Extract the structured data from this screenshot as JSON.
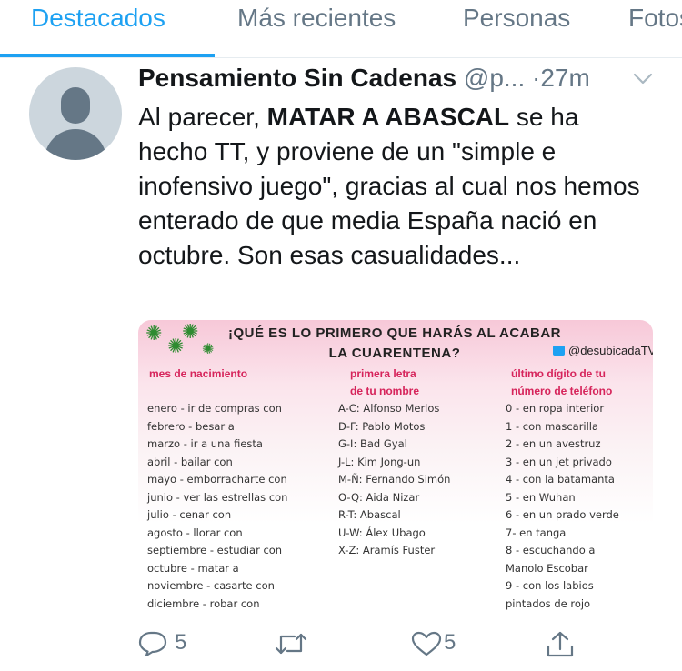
{
  "tabs": [
    {
      "label": "Destacados",
      "active": true
    },
    {
      "label": "Más recientes",
      "active": false
    },
    {
      "label": "Personas",
      "active": false
    },
    {
      "label": "Fotos",
      "active": false
    }
  ],
  "tweet": {
    "author_name": "Pensamiento Sin Cadenas",
    "handle": "@p...",
    "separator": "·",
    "time": "27m",
    "text_parts": [
      {
        "text": "Al parecer, ",
        "bold": false
      },
      {
        "text": "MATAR A ABASCAL",
        "bold": true
      },
      {
        "text": " se ha hecho TT, y proviene de un \"simple e inofensivo juego\", gracias al cual nos hemos enterado de que media España nació en octubre. Son esas casualidades...",
        "bold": false
      }
    ]
  },
  "image": {
    "title_line1": "¡QUÉ ES LO PRIMERO QUE HARÁS AL ACABAR",
    "title_line2": "LA CUARENTENA?",
    "handle": "@desubicadaTV",
    "col1_title": "mes de nacimiento",
    "col1_items": [
      "enero - ir de compras con",
      "febrero - besar a",
      "marzo - ir a una fiesta",
      "abril - bailar con",
      "mayo - emborracharte con",
      "junio - ver las estrellas con",
      "julio - cenar con",
      "agosto - llorar con",
      "septiembre - estudiar con",
      "octubre - matar a",
      "noviembre - casarte con",
      "diciembre - robar con"
    ],
    "col2_title_line1": "primera letra",
    "col2_title_line2": "de tu nombre",
    "col2_items": [
      "A-C: Alfonso Merlos",
      "D-F: Pablo Motos",
      "G-I: Bad Gyal",
      "J-L: Kim Jong-un",
      "M-Ñ: Fernando Simón",
      "O-Q: Aida Nizar",
      "R-T: Abascal",
      "U-W: Álex Ubago",
      "X-Z: Aramís Fuster"
    ],
    "col3_title_line1": "último dígito de tu",
    "col3_title_line2": "número de teléfono",
    "col3_items": [
      "0 - en ropa interior",
      "1 - con mascarilla",
      "2 - en un avestruz",
      "3 - en un jet privado",
      "4 - con la batamanta",
      "5 - en Wuhan",
      "6 - en un prado verde",
      "7- en tanga",
      "8 - escuchando a",
      "Manolo Escobar",
      "9 - con los labios",
      "pintados de rojo"
    ]
  },
  "actions": {
    "reply_count": "5",
    "retweet_count": "",
    "like_count": "5"
  },
  "icons": {
    "reply": "reply-icon",
    "retweet": "retweet-icon",
    "like": "heart-icon",
    "share": "share-icon",
    "menu": "chevron-down-icon"
  },
  "colors": {
    "accent": "#1da1f2",
    "secondary_text": "#657786",
    "image_heading": "#d6245b"
  }
}
